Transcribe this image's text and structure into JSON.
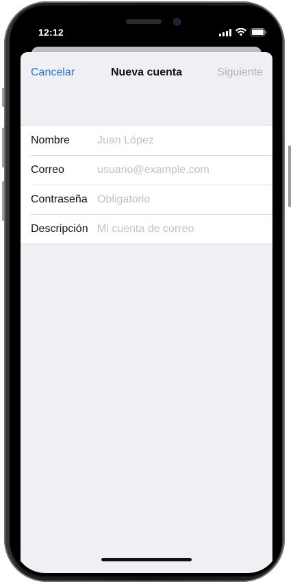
{
  "status_bar": {
    "time": "12:12",
    "signal_icon": "cellular-signal-icon",
    "wifi_icon": "wifi-icon",
    "battery_icon": "battery-icon"
  },
  "nav": {
    "cancel_label": "Cancelar",
    "title": "Nueva cuenta",
    "next_label": "Siguiente"
  },
  "form": {
    "rows": [
      {
        "label": "Nombre",
        "value": "",
        "placeholder": "Juan López"
      },
      {
        "label": "Correo",
        "value": "",
        "placeholder": "usuario@example.com"
      },
      {
        "label": "Contraseña",
        "value": "",
        "placeholder": "Obligatorio"
      },
      {
        "label": "Descripción",
        "value": "",
        "placeholder": "Mi cuenta de correo"
      }
    ]
  },
  "colors": {
    "accent": "#1a7adf",
    "disabled": "#b3b3b7",
    "sheet_background": "#f0eff4",
    "placeholder": "#c2c2c6"
  }
}
